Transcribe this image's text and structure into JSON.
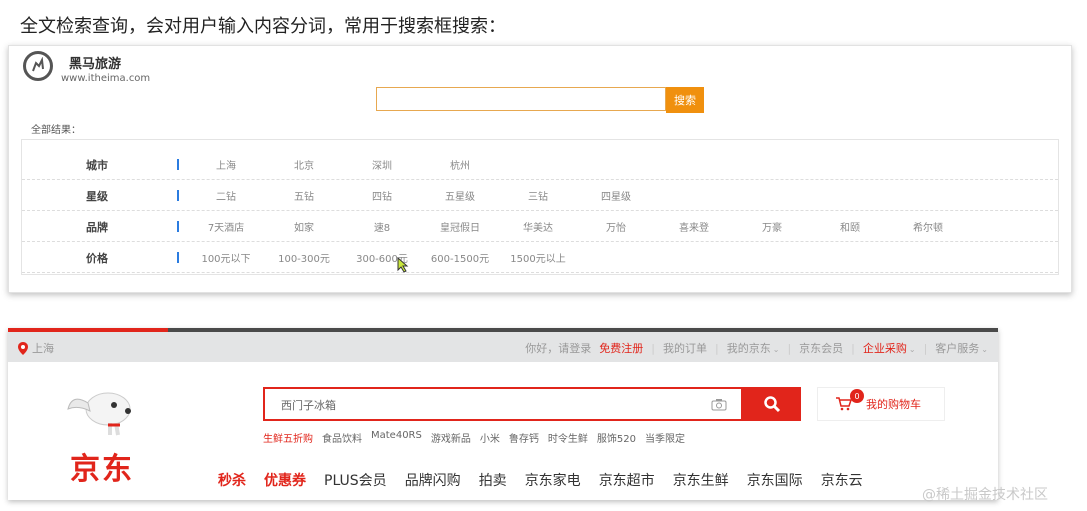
{
  "heading": "全文检索查询，会对用户输入内容分词，常用于搜索框搜索：",
  "travel": {
    "brand_name": "黑马旅游",
    "brand_url": "www.itheima.com",
    "search_placeholder": "",
    "search_button": "搜索",
    "all_results": "全部结果：",
    "filters": [
      {
        "label": "城市",
        "options": [
          "上海",
          "北京",
          "深圳",
          "杭州"
        ]
      },
      {
        "label": "星级",
        "options": [
          "二钻",
          "五钻",
          "四钻",
          "五星级",
          "三钻",
          "四星级"
        ]
      },
      {
        "label": "品牌",
        "options": [
          "7天酒店",
          "如家",
          "速8",
          "皇冠假日",
          "华美达",
          "万怡",
          "喜来登",
          "万豪",
          "和颐",
          "希尔顿"
        ]
      },
      {
        "label": "价格",
        "options": [
          "100元以下",
          "100-300元",
          "300-600元",
          "600-1500元",
          "1500元以上"
        ]
      }
    ]
  },
  "jd": {
    "location": "上海",
    "greeting": "你好，请登录",
    "register": "免费注册",
    "my_orders": "我的订单",
    "my_jd": "我的京东",
    "jd_member": "京东会员",
    "enterprise": "企业采购",
    "customer_service": "客户服务",
    "logo_text": "京东",
    "search_placeholder": "西门子冰箱",
    "cart_label": "我的购物车",
    "cart_count": "0",
    "hotwords": [
      "生鲜五折购",
      "食品饮料",
      "Mate40RS",
      "游戏新品",
      "小米",
      "鲁存钙",
      "时令生鲜",
      "服饰520",
      "当季限定"
    ],
    "nav": [
      "秒杀",
      "优惠券",
      "PLUS会员",
      "品牌闪购",
      "拍卖",
      "京东家电",
      "京东超市",
      "京东生鲜",
      "京东国际",
      "京东云"
    ]
  },
  "watermark": "@稀土掘金技术社区",
  "colors": {
    "jd_red": "#e1251b",
    "travel_orange": "#f0900e",
    "filter_bar_blue": "#2b7ce0"
  }
}
